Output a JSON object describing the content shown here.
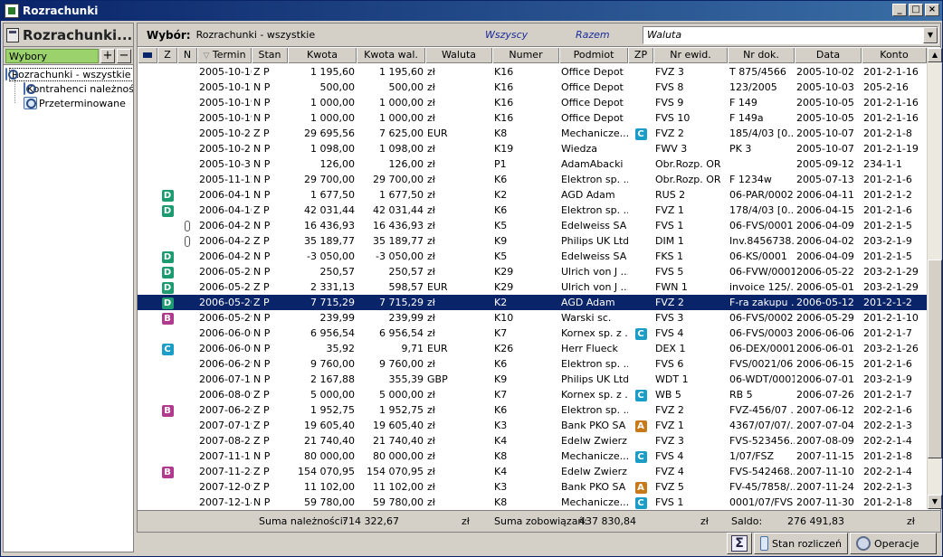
{
  "window": {
    "title": "Rozrachunki",
    "btn_min": "_",
    "btn_max": "□",
    "btn_close": "×"
  },
  "left": {
    "title": "Rozrachunki...",
    "wybory_label": "Wybory",
    "add": "+",
    "remove": "−",
    "tree": [
      {
        "label": "Rozrachunki - wszystkie"
      },
      {
        "label": "Kontrahenci należności"
      },
      {
        "label": "Przeterminowane"
      }
    ]
  },
  "filter": {
    "label": "Wybór:",
    "value": "Rozrachunki - wszystkie",
    "opt_all": "Wszyscy",
    "opt_together": "Razem",
    "combo": "Waluta",
    "combo_arrow": "▼"
  },
  "columns": {
    "c0": "",
    "z": "Z",
    "n": "N",
    "sortarr": "▽",
    "termin": "Termin",
    "stan": "Stan",
    "kwota": "Kwota",
    "kwota_wal": "Kwota wal.",
    "waluta": "Waluta",
    "numer": "Numer",
    "podmiot": "Podmiot",
    "zp": "ZP",
    "nr_ewid": "Nr ewid.",
    "nr_dok": "Nr dok.",
    "data": "Data",
    "konto": "Konto"
  },
  "rows": [
    {
      "z": "",
      "n": "",
      "termin": "2005-10-16",
      "stan": "Z P",
      "kwota": "1 195,60",
      "kwota_wal": "1 195,60",
      "waluta": "zł",
      "numer": "K16",
      "podmiot": "Office Depot",
      "zp": "",
      "nr_ewid": "FVZ  3",
      "nr_dok": "T 875/4566",
      "data": "2005-10-02",
      "konto": "201-2-1-16"
    },
    {
      "z": "",
      "n": "",
      "termin": "2005-10-17",
      "stan": "N P",
      "kwota": "500,00",
      "kwota_wal": "500,00",
      "waluta": "zł",
      "numer": "K16",
      "podmiot": "Office Depot",
      "zp": "",
      "nr_ewid": "FVS  8",
      "nr_dok": "123/2005",
      "data": "2005-10-03",
      "konto": "205-2-16"
    },
    {
      "z": "",
      "n": "",
      "termin": "2005-10-19",
      "stan": "N P",
      "kwota": "1 000,00",
      "kwota_wal": "1 000,00",
      "waluta": "zł",
      "numer": "K16",
      "podmiot": "Office Depot",
      "zp": "",
      "nr_ewid": "FVS  9",
      "nr_dok": "F 149",
      "data": "2005-10-05",
      "konto": "201-2-1-16"
    },
    {
      "z": "",
      "n": "",
      "termin": "2005-10-19",
      "stan": "N P",
      "kwota": "1 000,00",
      "kwota_wal": "1 000,00",
      "waluta": "zł",
      "numer": "K16",
      "podmiot": "Office Depot",
      "zp": "",
      "nr_ewid": "FVS  10",
      "nr_dok": "F 149a",
      "data": "2005-10-05",
      "konto": "201-2-1-16"
    },
    {
      "z": "",
      "n": "",
      "termin": "2005-10-21",
      "stan": "Z P",
      "kwota": "29 695,56",
      "kwota_wal": "7 625,00",
      "waluta": "EUR",
      "numer": "K8",
      "podmiot": "Mechanicze...",
      "zp": "C",
      "nr_ewid": "FVZ  2",
      "nr_dok": "185/4/03 [0...",
      "data": "2005-10-07",
      "konto": "201-2-1-8"
    },
    {
      "z": "",
      "n": "",
      "termin": "2005-10-21",
      "stan": "N P",
      "kwota": "1 098,00",
      "kwota_wal": "1 098,00",
      "waluta": "zł",
      "numer": "K19",
      "podmiot": "Wiedza",
      "zp": "",
      "nr_ewid": "FWV  3",
      "nr_dok": "PK 3",
      "data": "2005-10-07",
      "konto": "201-2-1-19"
    },
    {
      "z": "",
      "n": "",
      "termin": "2005-10-31",
      "stan": "N P",
      "kwota": "126,00",
      "kwota_wal": "126,00",
      "waluta": "zł",
      "numer": "P1",
      "podmiot": "AdamAbacki",
      "zp": "",
      "nr_ewid": "Obr.Rozp. OR",
      "nr_dok": "",
      "data": "2005-09-12",
      "konto": "234-1-1"
    },
    {
      "z": "",
      "n": "",
      "termin": "2005-11-12",
      "stan": "N P",
      "kwota": "29 700,00",
      "kwota_wal": "29 700,00",
      "waluta": "zł",
      "numer": "K6",
      "podmiot": "Elektron sp. ...",
      "zp": "",
      "nr_ewid": "Obr.Rozp. OR",
      "nr_dok": "F 1234w",
      "data": "2005-07-13",
      "konto": "201-2-1-6"
    },
    {
      "z": "D",
      "n": "",
      "termin": "2006-04-11",
      "stan": "N P",
      "kwota": "1 677,50",
      "kwota_wal": "1 677,50",
      "waluta": "zł",
      "numer": "K2",
      "podmiot": "AGD Adam",
      "zp": "",
      "nr_ewid": "RUS  2",
      "nr_dok": "06-PAR/0002",
      "data": "2006-04-11",
      "konto": "201-2-1-2"
    },
    {
      "z": "D",
      "n": "",
      "termin": "2006-04-16",
      "stan": "Z P",
      "kwota": "42 031,44",
      "kwota_wal": "42 031,44",
      "waluta": "zł",
      "numer": "K6",
      "podmiot": "Elektron sp. ...",
      "zp": "",
      "nr_ewid": "FVZ  1",
      "nr_dok": "178/4/03 [0...",
      "data": "2006-04-15",
      "konto": "201-2-1-6"
    },
    {
      "z": "",
      "n": "clip",
      "termin": "2006-04-23",
      "stan": "N P",
      "kwota": "16 436,93",
      "kwota_wal": "16 436,93",
      "waluta": "zł",
      "numer": "K5",
      "podmiot": "Edelweiss SA",
      "zp": "",
      "nr_ewid": "FVS  1",
      "nr_dok": "06-FVS/0001",
      "data": "2006-04-09",
      "konto": "201-2-1-5"
    },
    {
      "z": "",
      "n": "clip",
      "termin": "2006-04-23",
      "stan": "Z P",
      "kwota": "35 189,77",
      "kwota_wal": "35 189,77",
      "waluta": "zł",
      "numer": "K9",
      "podmiot": "Philips UK Ltd",
      "zp": "",
      "nr_ewid": "DIM  1",
      "nr_dok": "Inv.8456738...",
      "data": "2006-04-02",
      "konto": "203-2-1-9"
    },
    {
      "z": "D",
      "n": "",
      "termin": "2006-04-23",
      "stan": "N P",
      "kwota": "-3 050,00",
      "kwota_wal": "-3 050,00",
      "waluta": "zł",
      "numer": "K5",
      "podmiot": "Edelweiss SA",
      "zp": "",
      "nr_ewid": "FKS  1",
      "nr_dok": "06-KS/0001",
      "data": "2006-04-09",
      "konto": "201-2-1-5"
    },
    {
      "z": "D",
      "n": "",
      "termin": "2006-05-22",
      "stan": "N P",
      "kwota": "250,57",
      "kwota_wal": "250,57",
      "waluta": "zł",
      "numer": "K29",
      "podmiot": "Ulrich von J ...",
      "zp": "",
      "nr_ewid": "FVS  5",
      "nr_dok": "06-FVW/0001",
      "data": "2006-05-22",
      "konto": "203-2-1-29"
    },
    {
      "z": "D",
      "n": "",
      "termin": "2006-05-25",
      "stan": "Z P",
      "kwota": "2 331,13",
      "kwota_wal": "598,57",
      "waluta": "EUR",
      "numer": "K29",
      "podmiot": "Ulrich von J ...",
      "zp": "",
      "nr_ewid": "FWN  1",
      "nr_dok": "invoice 125/...",
      "data": "2006-05-01",
      "konto": "203-2-1-29"
    },
    {
      "z": "D",
      "n": "",
      "termin": "2006-05-26",
      "stan": "Z P",
      "kwota": "7 715,29",
      "kwota_wal": "7 715,29",
      "waluta": "zł",
      "numer": "K2",
      "podmiot": "AGD Adam",
      "zp": "",
      "nr_ewid": "FVZ  2",
      "nr_dok": "F-ra zakupu ...",
      "data": "2006-05-12",
      "konto": "201-2-1-2",
      "selected": true
    },
    {
      "z": "B",
      "n": "",
      "termin": "2006-05-29",
      "stan": "N P",
      "kwota": "239,99",
      "kwota_wal": "239,99",
      "waluta": "zł",
      "numer": "K10",
      "podmiot": "Warski sc.",
      "zp": "",
      "nr_ewid": "FVS  3",
      "nr_dok": "06-FVS/0002",
      "data": "2006-05-29",
      "konto": "201-2-1-10"
    },
    {
      "z": "",
      "n": "",
      "termin": "2006-06-06",
      "stan": "N P",
      "kwota": "6 956,54",
      "kwota_wal": "6 956,54",
      "waluta": "zł",
      "numer": "K7",
      "podmiot": "Kornex sp. z ...",
      "zp": "C",
      "nr_ewid": "FVS  4",
      "nr_dok": "06-FVS/0003",
      "data": "2006-06-06",
      "konto": "201-2-1-7"
    },
    {
      "z": "C",
      "n": "",
      "termin": "2006-06-06",
      "stan": "N P",
      "kwota": "35,92",
      "kwota_wal": "9,71",
      "waluta": "EUR",
      "numer": "K26",
      "podmiot": "Herr Flueck",
      "zp": "",
      "nr_ewid": "DEX  1",
      "nr_dok": "06-DEX/0001",
      "data": "2006-06-01",
      "konto": "203-2-1-26"
    },
    {
      "z": "",
      "n": "",
      "termin": "2006-06-29",
      "stan": "N P",
      "kwota": "9 760,00",
      "kwota_wal": "9 760,00",
      "waluta": "zł",
      "numer": "K6",
      "podmiot": "Elektron sp. ...",
      "zp": "",
      "nr_ewid": "FVS  6",
      "nr_dok": "FVS/0021/06",
      "data": "2006-06-15",
      "konto": "201-2-1-6"
    },
    {
      "z": "",
      "n": "",
      "termin": "2006-07-15",
      "stan": "N P",
      "kwota": "2 167,88",
      "kwota_wal": "355,39",
      "waluta": "GBP",
      "numer": "K9",
      "podmiot": "Philips UK Ltd",
      "zp": "",
      "nr_ewid": "WDT  1",
      "nr_dok": "06-WDT/0001",
      "data": "2006-07-01",
      "konto": "203-2-1-9"
    },
    {
      "z": "",
      "n": "",
      "termin": "2006-08-09",
      "stan": "Z P",
      "kwota": "5 000,00",
      "kwota_wal": "5 000,00",
      "waluta": "zł",
      "numer": "K7",
      "podmiot": "Kornex sp. z ...",
      "zp": "C",
      "nr_ewid": "WB  5",
      "nr_dok": "RB 5",
      "data": "2006-07-26",
      "konto": "201-2-1-7"
    },
    {
      "z": "B",
      "n": "",
      "termin": "2007-06-26",
      "stan": "Z P",
      "kwota": "1 952,75",
      "kwota_wal": "1 952,75",
      "waluta": "zł",
      "numer": "K6",
      "podmiot": "Elektron sp. ...",
      "zp": "",
      "nr_ewid": "FVZ  2",
      "nr_dok": "FVZ-456/07 ...",
      "data": "2007-06-12",
      "konto": "202-2-1-6"
    },
    {
      "z": "",
      "n": "",
      "termin": "2007-07-19",
      "stan": "Z P",
      "kwota": "19 605,40",
      "kwota_wal": "19 605,40",
      "waluta": "zł",
      "numer": "K3",
      "podmiot": "Bank PKO SA",
      "zp": "A",
      "nr_ewid": "FVZ  1",
      "nr_dok": "4367/07/07/...",
      "data": "2007-07-04",
      "konto": "202-2-1-3"
    },
    {
      "z": "",
      "n": "",
      "termin": "2007-08-25",
      "stan": "Z P",
      "kwota": "21 740,40",
      "kwota_wal": "21 740,40",
      "waluta": "zł",
      "numer": "K4",
      "podmiot": "Edelw Zwierz...",
      "zp": "",
      "nr_ewid": "FVZ  3",
      "nr_dok": "FVS-523456...",
      "data": "2007-08-09",
      "konto": "202-2-1-4"
    },
    {
      "z": "",
      "n": "",
      "termin": "2007-11-15",
      "stan": "N P",
      "kwota": "80 000,00",
      "kwota_wal": "80 000,00",
      "waluta": "zł",
      "numer": "K8",
      "podmiot": "Mechanicze...",
      "zp": "C",
      "nr_ewid": "FVS  4",
      "nr_dok": "1/07/FSZ",
      "data": "2007-11-15",
      "konto": "201-2-1-8"
    },
    {
      "z": "B",
      "n": "",
      "termin": "2007-11-28",
      "stan": "Z P",
      "kwota": "154 070,95",
      "kwota_wal": "154 070,95",
      "waluta": "zł",
      "numer": "K4",
      "podmiot": "Edelw Zwierz...",
      "zp": "",
      "nr_ewid": "FVZ  4",
      "nr_dok": "FVS-542468...",
      "data": "2007-11-10",
      "konto": "202-2-1-4"
    },
    {
      "z": "",
      "n": "",
      "termin": "2007-12-09",
      "stan": "Z P",
      "kwota": "11 102,00",
      "kwota_wal": "11 102,00",
      "waluta": "zł",
      "numer": "K3",
      "podmiot": "Bank PKO SA",
      "zp": "A",
      "nr_ewid": "FVZ  5",
      "nr_dok": "FV-45/7858/...",
      "data": "2007-11-24",
      "konto": "202-2-1-3"
    },
    {
      "z": "",
      "n": "",
      "termin": "2007-12-14",
      "stan": "N P",
      "kwota": "59 780,00",
      "kwota_wal": "59 780,00",
      "waluta": "zł",
      "numer": "K8",
      "podmiot": "Mechanicze...",
      "zp": "C",
      "nr_ewid": "FVS  1",
      "nr_dok": "0001/07/FVS",
      "data": "2007-11-30",
      "konto": "201-2-1-8"
    }
  ],
  "summary": {
    "naleznosci_label": "Suma należności:",
    "naleznosci_value": "714 322,67",
    "naleznosci_cur": "zł",
    "zobowiazan_label": "Suma zobowiązań:",
    "zobowiazan_value": "437 830,84",
    "zobowiazan_cur": "zł",
    "saldo_label": "Saldo:",
    "saldo_value": "276 491,83",
    "saldo_cur": "zł"
  },
  "toolbar": {
    "sigma": "Σ",
    "stan": "Stan rozliczeń",
    "operacje": "Operacje"
  },
  "scroll": {
    "up": "▲",
    "down": "▼"
  }
}
